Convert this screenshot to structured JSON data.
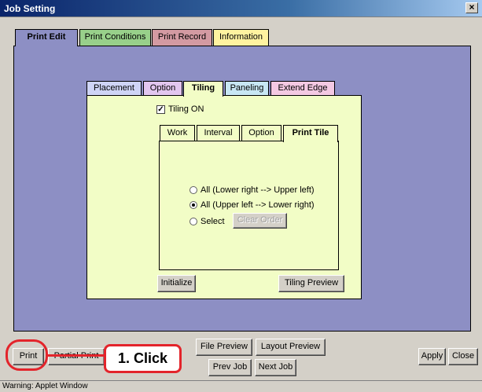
{
  "window": {
    "title": "Job Setting",
    "close_glyph": "×"
  },
  "main_tabs": [
    "Print Edit",
    "Print Conditions",
    "Print Record",
    "Information"
  ],
  "main_tab_colors": [
    "#8d8fc4",
    "#98d08a",
    "#d39aa2",
    "#fff3a0"
  ],
  "sub_tabs": [
    "Placement",
    "Option",
    "Tiling",
    "Paneling",
    "Extend Edge"
  ],
  "sub_tab_colors": [
    "#cfd4f6",
    "#e2c6ef",
    "#f2fdc6",
    "#c8e7f4",
    "#f4c9e3"
  ],
  "tiling": {
    "checkbox_label": "Tiling ON",
    "checked": true,
    "check_glyph": "✓",
    "inner_tabs": [
      "Work",
      "Interval",
      "Option",
      "Print Tile"
    ],
    "radio_options": [
      {
        "label": "All (Lower right --> Upper left)",
        "selected": false
      },
      {
        "label": "All (Upper left --> Lower right)",
        "selected": true
      },
      {
        "label": "Select",
        "selected": false
      }
    ],
    "clear_order_label": "Clear Order",
    "initialize_label": "Initialize",
    "tiling_preview_label": "Tiling Preview"
  },
  "bottom": {
    "print_label": "Print",
    "partial_print_label": "Partial Print",
    "file_preview_label": "File Preview",
    "layout_preview_label": "Layout Preview",
    "prev_job_label": "Prev Job",
    "next_job_label": "Next Job",
    "apply_label": "Apply",
    "close_label": "Close"
  },
  "annotation": {
    "label": "1. Click",
    "color": "#e3242b"
  },
  "status_text": "Warning: Applet Window"
}
